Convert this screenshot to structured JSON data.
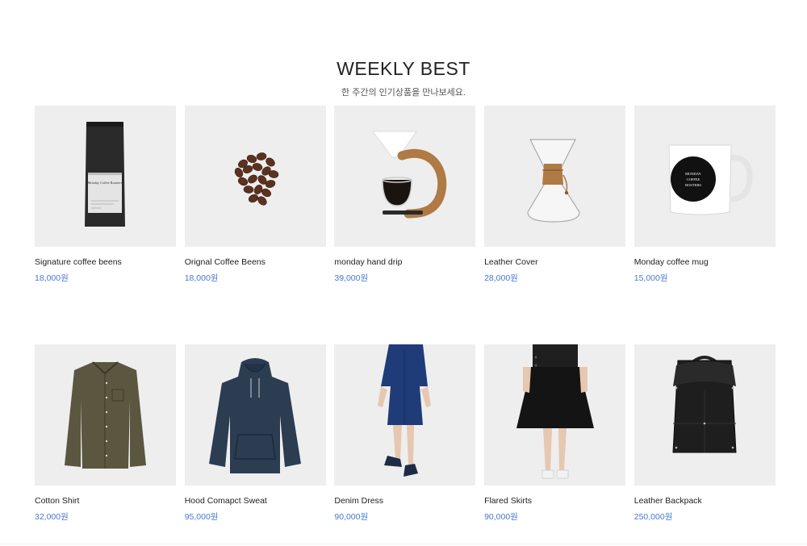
{
  "section": {
    "title": "WEEKLY BEST",
    "subtitle": "한 주간의 인기상품을 만나보세요."
  },
  "products": [
    {
      "name": "Signature coffee beens",
      "price": "18,000원",
      "icon": "coffee-bag-icon"
    },
    {
      "name": "Orignal Coffee Beens",
      "price": "18,000원",
      "icon": "coffee-beans-icon"
    },
    {
      "name": "monday hand drip",
      "price": "39,000원",
      "icon": "hand-drip-icon"
    },
    {
      "name": "Leather Cover",
      "price": "28,000원",
      "icon": "chemex-icon"
    },
    {
      "name": "Monday coffee mug",
      "price": "15,000원",
      "icon": "mug-icon"
    },
    {
      "name": "Cotton Shirt",
      "price": "32,000원",
      "icon": "shirt-icon"
    },
    {
      "name": "Hood Comapct Sweat",
      "price": "95,000원",
      "icon": "hoodie-icon"
    },
    {
      "name": "Denim Dress",
      "price": "90,000원",
      "icon": "dress-icon"
    },
    {
      "name": "Flared Skirts",
      "price": "90,000원",
      "icon": "skirt-icon"
    },
    {
      "name": "Leather Backpack",
      "price": "250,000원",
      "icon": "backpack-icon"
    }
  ],
  "artwork": {
    "bag_label": "Monday Coffee Roasters",
    "mug_label": "MONDAY COFFEE ROSTERS"
  },
  "colors": {
    "price": "#4a78d0",
    "thumb_bg": "#eeeeee"
  }
}
